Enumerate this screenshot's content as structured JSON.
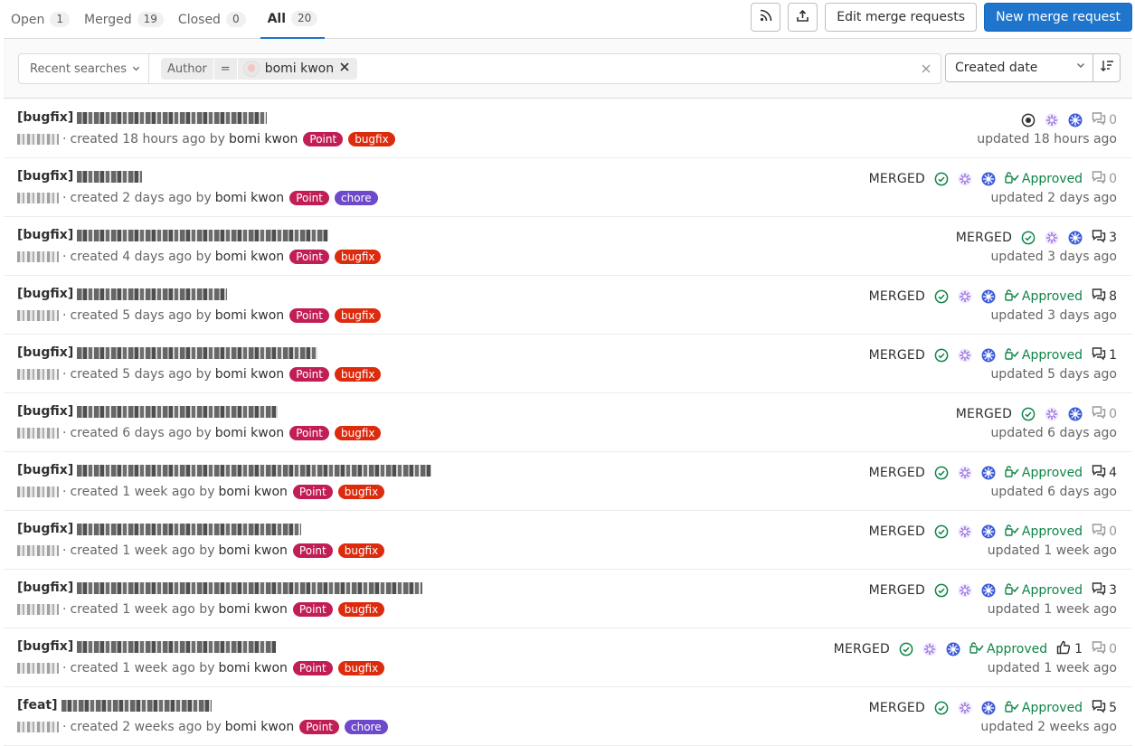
{
  "tabs": [
    {
      "label": "Open",
      "count": "1"
    },
    {
      "label": "Merged",
      "count": "19"
    },
    {
      "label": "Closed",
      "count": "0"
    },
    {
      "label": "All",
      "count": "20"
    }
  ],
  "actions": {
    "rss_icon": "rss-icon",
    "export_icon": "export-icon",
    "edit_label": "Edit merge requests",
    "new_label": "New merge request"
  },
  "filter": {
    "recent_label": "Recent searches",
    "token_field": "Author",
    "token_operator": "=",
    "token_value": "bomi kwon",
    "sort_label": "Created date"
  },
  "status": {
    "merged": "MERGED",
    "approved": "Approved"
  },
  "colors": {
    "accent": "#1f75cb",
    "approved": "#108548",
    "label_point": "#c21e56",
    "label_bugfix": "#dd2b0e",
    "label_chore": "#6e49cb"
  },
  "mrs": [
    {
      "prefix": "[bugfix]",
      "created": "created 18 hours ago by",
      "author": "bomi kwon",
      "labels": [
        "Point",
        "bugfix"
      ],
      "merged": false,
      "approved": false,
      "upvotes": "",
      "comments": "0",
      "updated": "updated 18 hours ago"
    },
    {
      "prefix": "[bugfix]",
      "created": "created 2 days ago by",
      "author": "bomi kwon",
      "labels": [
        "Point",
        "chore"
      ],
      "merged": true,
      "approved": true,
      "upvotes": "",
      "comments": "0",
      "updated": "updated 2 days ago"
    },
    {
      "prefix": "[bugfix]",
      "created": "created 4 days ago by",
      "author": "bomi kwon",
      "labels": [
        "Point",
        "bugfix"
      ],
      "merged": true,
      "approved": false,
      "upvotes": "",
      "comments": "3",
      "updated": "updated 3 days ago"
    },
    {
      "prefix": "[bugfix]",
      "created": "created 5 days ago by",
      "author": "bomi kwon",
      "labels": [
        "Point",
        "bugfix"
      ],
      "merged": true,
      "approved": true,
      "upvotes": "",
      "comments": "8",
      "updated": "updated 3 days ago"
    },
    {
      "prefix": "[bugfix]",
      "created": "created 5 days ago by",
      "author": "bomi kwon",
      "labels": [
        "Point",
        "bugfix"
      ],
      "merged": true,
      "approved": true,
      "upvotes": "",
      "comments": "1",
      "updated": "updated 5 days ago"
    },
    {
      "prefix": "[bugfix]",
      "created": "created 6 days ago by",
      "author": "bomi kwon",
      "labels": [
        "Point",
        "bugfix"
      ],
      "merged": true,
      "approved": false,
      "upvotes": "",
      "comments": "0",
      "updated": "updated 6 days ago"
    },
    {
      "prefix": "[bugfix]",
      "created": "created 1 week ago by",
      "author": "bomi kwon",
      "labels": [
        "Point",
        "bugfix"
      ],
      "merged": true,
      "approved": true,
      "upvotes": "",
      "comments": "4",
      "updated": "updated 6 days ago"
    },
    {
      "prefix": "[bugfix]",
      "created": "created 1 week ago by",
      "author": "bomi kwon",
      "labels": [
        "Point",
        "bugfix"
      ],
      "merged": true,
      "approved": true,
      "upvotes": "",
      "comments": "0",
      "updated": "updated 1 week ago"
    },
    {
      "prefix": "[bugfix]",
      "created": "created 1 week ago by",
      "author": "bomi kwon",
      "labels": [
        "Point",
        "bugfix"
      ],
      "merged": true,
      "approved": true,
      "upvotes": "",
      "comments": "3",
      "updated": "updated 1 week ago"
    },
    {
      "prefix": "[bugfix]",
      "created": "created 1 week ago by",
      "author": "bomi kwon",
      "labels": [
        "Point",
        "bugfix"
      ],
      "merged": true,
      "approved": true,
      "upvotes": "1",
      "comments": "0",
      "updated": "updated 1 week ago"
    },
    {
      "prefix": "[feat]",
      "created": "created 2 weeks ago by",
      "author": "bomi kwon",
      "labels": [
        "Point",
        "chore"
      ],
      "merged": true,
      "approved": true,
      "upvotes": "",
      "comments": "5",
      "updated": "updated 2 weeks ago"
    }
  ]
}
